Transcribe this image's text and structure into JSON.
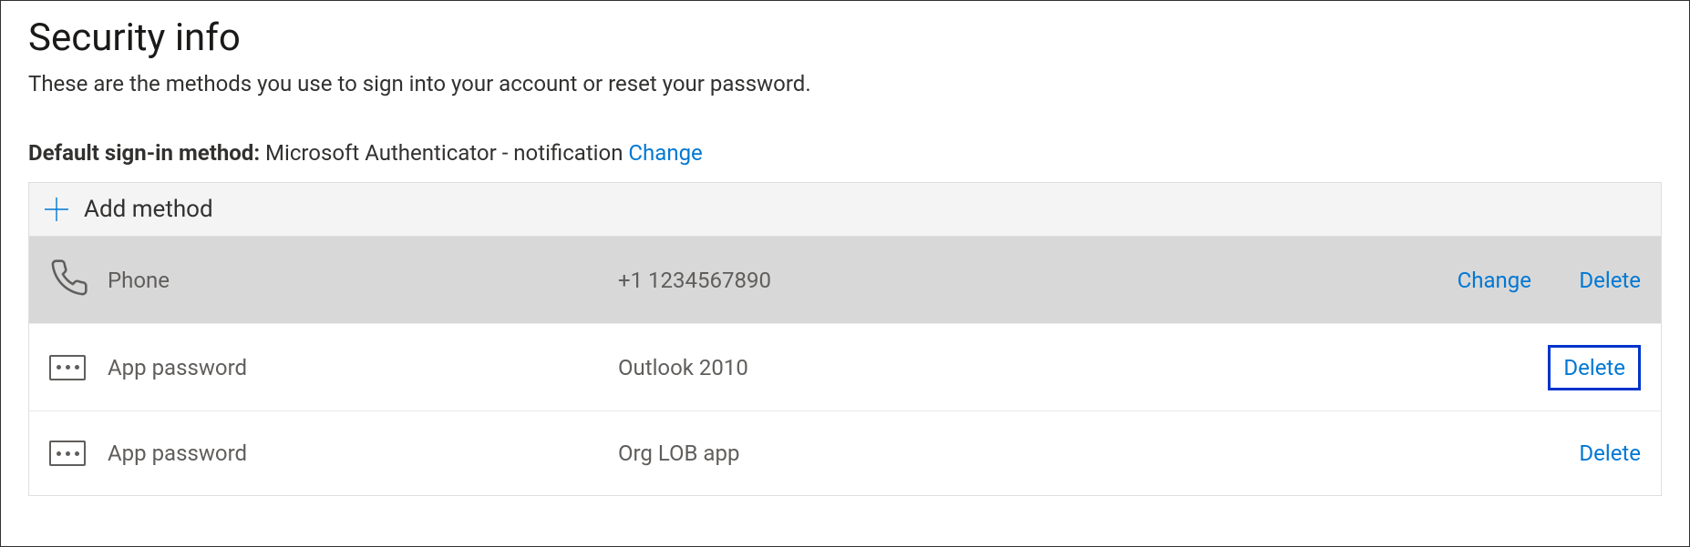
{
  "page": {
    "title": "Security info",
    "subtitle": "These are the methods you use to sign into your account or reset your password."
  },
  "defaultMethod": {
    "label": "Default sign-in method:",
    "value": "Microsoft Authenticator - notification",
    "changeLabel": "Change"
  },
  "addMethod": {
    "label": "Add method"
  },
  "methods": [
    {
      "icon": "phone-icon",
      "name": "Phone",
      "detail": "+1 1234567890",
      "changeLabel": "Change",
      "deleteLabel": "Delete",
      "active": true,
      "showChange": true,
      "highlightDelete": false
    },
    {
      "icon": "password-icon",
      "name": "App password",
      "detail": "Outlook 2010",
      "changeLabel": "",
      "deleteLabel": "Delete",
      "active": false,
      "showChange": false,
      "highlightDelete": true
    },
    {
      "icon": "password-icon",
      "name": "App password",
      "detail": "Org LOB app",
      "changeLabel": "",
      "deleteLabel": "Delete",
      "active": false,
      "showChange": false,
      "highlightDelete": false
    }
  ]
}
